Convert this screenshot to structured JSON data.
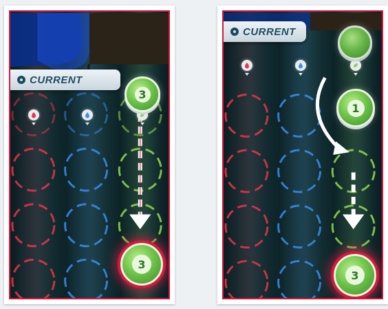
{
  "panels": [
    {
      "banner": {
        "label": "CURRENT",
        "icon": "info-dot-icon"
      },
      "columns": [
        {
          "color": "#e8364a",
          "icon": "flame-icon"
        },
        {
          "color": "#3a8ef0",
          "icon": "droplet-icon"
        },
        {
          "color": "#8bd14a",
          "icon": "leaf-icon"
        }
      ],
      "current_token": {
        "value": "3",
        "column": 3
      },
      "placed_token": {
        "value": "3",
        "column": 3,
        "row": 4
      },
      "arrow": "straight-down"
    },
    {
      "banner": {
        "label": "CURRENT",
        "icon": "info-dot-icon"
      },
      "columns": [
        {
          "color": "#e8364a",
          "icon": "flame-icon"
        },
        {
          "color": "#3a8ef0",
          "icon": "droplet-icon"
        },
        {
          "color": "#8bd14a",
          "icon": "leaf-icon"
        }
      ],
      "queued_token": {
        "value": "1",
        "column": 3
      },
      "placed_token": {
        "value": "3",
        "column": 3,
        "row": 4
      },
      "arrow": "curved-then-down"
    }
  ],
  "colors": {
    "border": "#d9163a",
    "red": "#e8364a",
    "blue": "#3a8ef0",
    "green": "#8bd14a",
    "token": "#6fc44a",
    "arrow": "#ffffff"
  }
}
